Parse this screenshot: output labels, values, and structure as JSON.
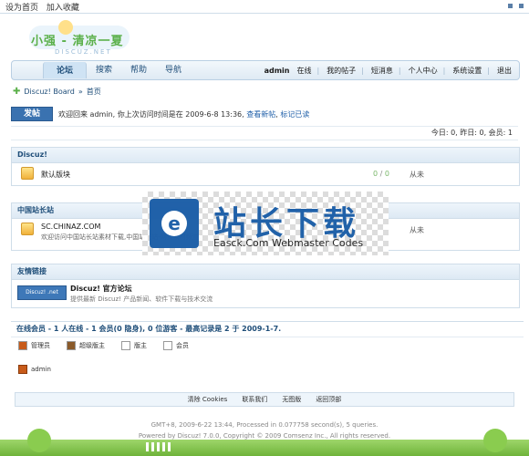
{
  "topbar": {
    "links": [
      "设为首页",
      "加入收藏"
    ]
  },
  "logo": {
    "title": "小强 - 清凉一夏",
    "subtitle": "DISCUZ.NET"
  },
  "nav": {
    "tabs": [
      "论坛",
      "搜索",
      "帮助",
      "导航"
    ],
    "user": "admin",
    "status": "在线",
    "links": [
      "我的帖子",
      "短消息",
      "个人中心",
      "系统设置",
      "退出"
    ]
  },
  "breadcrumb": {
    "board": "Discuz! Board",
    "sep": "»",
    "current": "首页"
  },
  "post_button": "发帖",
  "welcome": {
    "text": "欢迎回来 admin, 你上次访问时间是在 2009-6-8 13:36,",
    "link1": "查看新帖",
    "sep": ",",
    "link2": "标记已读"
  },
  "stats": "今日: 0, 昨日: 0, 会员: 1",
  "sections": [
    {
      "title": "Discuz!",
      "forums": [
        {
          "name": "默认版块",
          "topics": "0",
          "posts": "0",
          "last": "从未"
        }
      ]
    },
    {
      "title": "中国站长站",
      "forums": [
        {
          "name": "SC.CHINAZ.COM",
          "desc": "欢迎访问中国站长站素材下载,中国站长站-网页素材频道为站长提供更多更专业的素材服务。",
          "last": "从未"
        }
      ]
    }
  ],
  "friends": {
    "title": "友情链接",
    "logo_text": "Discuz! .net",
    "name": "Discuz! 官方论坛",
    "desc": "提供最新 Discuz! 产品新闻、软件下载与技术交流"
  },
  "online": {
    "text": "在线会员 - 1 人在线 - 1 会员(0 隐身), 0 位游客 - 最高记录是 2 于 2009-1-7.",
    "legend": [
      "管理员",
      "超级版主",
      "版主",
      "会员"
    ],
    "users": [
      "admin"
    ]
  },
  "footer": {
    "links": [
      "清除 Cookies",
      "联系我们",
      "无图版",
      "返回顶部"
    ],
    "meta": "GMT+8, 2009-6-22 13:44, Processed in 0.077758 second(s), 5 queries.",
    "powered": "Powered by Discuz! 7.0.0, Copyright © 2009 Comsenz Inc., All rights reserved."
  },
  "watermark": {
    "icon": "e",
    "title": "站长下载",
    "subtitle": "Easck.Com Webmaster Codes"
  },
  "colors": {
    "accent": "#1f4e79",
    "post_button": "#3a72b0",
    "logo_green": "#5bb04a"
  }
}
